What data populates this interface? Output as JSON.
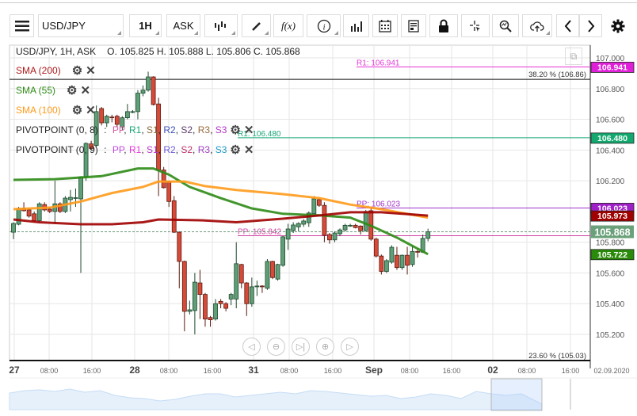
{
  "toolbar": {
    "menu_icon": "hamburger-icon",
    "symbol": "USD/JPY",
    "interval": "1H",
    "price_type": "ASK",
    "buttons": [
      "candlestick-icon",
      "pencil-icon",
      "function-icon",
      "info-icon",
      "bar-chart-icon",
      "calendar-icon",
      "document-icon",
      "lock-icon",
      "crosshair-icon",
      "zoom-chart-icon",
      "cloud-upload-icon",
      "chevron-left-icon",
      "chevron-right-icon",
      "gear-icon"
    ],
    "fx_label": "f(x)"
  },
  "header": {
    "title": "USD/JPY, 1H, ASK",
    "ohlc": "O. 105.825  H. 105.888  L. 105.806  C. 105.868"
  },
  "indicators": [
    {
      "label": "SMA (200)",
      "color": "#b0181b"
    },
    {
      "label": "SMA (55)",
      "color": "#2e8b16"
    },
    {
      "label": "SMA (100)",
      "color": "#ff9a1a"
    }
  ],
  "pivots": [
    {
      "label": "PIVOTPOINT (0, 8)",
      "sep": " : ",
      "levels": [
        {
          "t": "PP",
          "c": "#d45aa0"
        },
        {
          "t": "R1",
          "c": "#19a678"
        },
        {
          "t": "S1",
          "c": "#8b6a3a"
        },
        {
          "t": "R2",
          "c": "#3b4fb5"
        },
        {
          "t": "S2",
          "c": "#5a3a6a"
        },
        {
          "t": "R3",
          "c": "#9a6a3a"
        },
        {
          "t": "S3",
          "c": "#b535c8"
        }
      ]
    },
    {
      "label": "PIVOTPOINT (0, 9)",
      "sep": " : ",
      "levels": [
        {
          "t": "PP",
          "c": "#c048e0"
        },
        {
          "t": "R1",
          "c": "#e535d8"
        },
        {
          "t": "S1",
          "c": "#b535c8"
        },
        {
          "t": "R2",
          "c": "#6a5ad8"
        },
        {
          "t": "S2",
          "c": "#c0306a"
        },
        {
          "t": "R3",
          "c": "#a040c0"
        },
        {
          "t": "S3",
          "c": "#1a9ac8"
        }
      ]
    }
  ],
  "levels": {
    "r1_a": {
      "label": "R1: 106.941",
      "value": 106.941,
      "color": "#e535d8"
    },
    "r1_b": {
      "label": "R1: 106.480",
      "value": 106.48,
      "color": "#19a678"
    },
    "pp_a": {
      "label": "PP: 106.023",
      "value": 106.023,
      "color": "#a030c8"
    },
    "pp_b": {
      "label": "PP: 105.842",
      "value": 105.842,
      "color": "#d040a0"
    },
    "fib_top": {
      "label": "38.20 % (106.86)",
      "value": 106.86
    },
    "fib_bottom": {
      "label": "23.60 % (105.03)",
      "value": 105.03
    }
  },
  "price_tags": [
    {
      "text": "106.941",
      "value": 106.941,
      "bg": "#e020d8"
    },
    {
      "text": "106.480",
      "value": 106.48,
      "bg": "#13a86e"
    },
    {
      "text": "106.023",
      "value": 106.023,
      "bg": "#a020c8"
    },
    {
      "text": "105.973",
      "value": 105.973,
      "bg": "#a00000"
    },
    {
      "text": "105.722",
      "value": 105.722,
      "bg": "#2a8a0a"
    }
  ],
  "current_price": {
    "text": "105.868",
    "value": 105.868,
    "bg": "#6aa07a"
  },
  "nav_buttons": [
    "scroll-left-icon",
    "zoom-out-icon",
    "reset-icon",
    "zoom-in-icon",
    "scroll-right-icon"
  ],
  "chart_data": {
    "type": "candlestick",
    "yaxis": {
      "ticks": [
        "107.000",
        "106.800",
        "106.600",
        "106.400",
        "106.200",
        "105.800",
        "105.600",
        "105.400",
        "105.200"
      ],
      "ylim": [
        105.1,
        107.08
      ]
    },
    "xaxis": {
      "ticks": [
        "27",
        "08:00",
        "16:00",
        "28",
        "08:00",
        "16:00",
        "31",
        "08:00",
        "16:00",
        "Sep",
        "08:00",
        "16:00",
        "02",
        "08:00",
        "16:00"
      ],
      "date_label": "02.09.2020"
    },
    "colors": {
      "up": "#5f9e77",
      "down": "#d84a38"
    },
    "ohlc": [
      [
        105.865,
        105.93,
        105.82,
        105.922
      ],
      [
        105.917,
        106.03,
        105.91,
        106.02
      ],
      [
        106.02,
        106.06,
        106.0,
        106.005
      ],
      [
        106.01,
        106.02,
        105.96,
        105.97
      ],
      [
        105.985,
        106.0,
        105.93,
        105.94
      ],
      [
        105.94,
        106.06,
        105.93,
        106.05
      ],
      [
        106.045,
        106.06,
        106.0,
        106.01
      ],
      [
        106.015,
        106.03,
        105.99,
        106.0
      ],
      [
        106.0,
        106.2,
        105.92,
        106.05
      ],
      [
        106.05,
        106.06,
        105.99,
        106.0
      ],
      [
        106.0,
        106.1,
        105.99,
        106.087
      ],
      [
        106.077,
        106.14,
        106.0,
        106.092
      ],
      [
        106.085,
        106.15,
        106.03,
        106.09
      ],
      [
        106.082,
        106.23,
        105.6,
        106.226
      ],
      [
        106.226,
        106.45,
        106.2,
        106.443
      ],
      [
        106.44,
        106.46,
        106.4,
        106.41
      ],
      [
        106.43,
        106.69,
        106.42,
        106.65
      ],
      [
        106.67,
        106.68,
        106.56,
        106.577
      ],
      [
        106.577,
        106.63,
        106.55,
        106.62
      ],
      [
        106.615,
        106.63,
        106.58,
        106.61
      ],
      [
        106.62,
        106.63,
        106.55,
        106.567
      ],
      [
        106.55,
        106.62,
        106.53,
        106.61
      ],
      [
        106.61,
        106.7,
        106.6,
        106.65
      ],
      [
        106.65,
        106.66,
        106.64,
        106.65
      ],
      [
        106.65,
        106.79,
        106.6,
        106.77
      ],
      [
        106.77,
        106.82,
        106.75,
        106.79
      ],
      [
        106.79,
        106.91,
        106.78,
        106.876
      ],
      [
        106.876,
        106.88,
        106.69,
        106.696
      ],
      [
        106.7,
        106.74,
        106.1,
        106.27
      ],
      [
        106.27,
        106.29,
        106.15,
        106.155
      ],
      [
        106.195,
        106.2,
        106.03,
        106.065
      ],
      [
        106.07,
        106.1,
        105.86,
        105.865
      ],
      [
        105.865,
        105.87,
        105.5,
        105.675
      ],
      [
        105.675,
        105.68,
        105.22,
        105.35
      ],
      [
        105.35,
        105.42,
        105.33,
        105.36
      ],
      [
        105.355,
        105.6,
        105.2,
        105.54
      ],
      [
        105.535,
        105.62,
        105.3,
        105.46
      ],
      [
        105.46,
        105.47,
        105.25,
        105.3
      ],
      [
        105.31,
        105.32,
        105.25,
        105.295
      ],
      [
        105.3,
        105.43,
        105.29,
        105.4
      ],
      [
        105.415,
        105.43,
        105.37,
        105.4
      ],
      [
        105.4,
        105.41,
        105.35,
        105.37
      ],
      [
        105.43,
        105.47,
        105.39,
        105.46
      ],
      [
        105.43,
        105.8,
        105.37,
        105.66
      ],
      [
        105.655,
        105.66,
        105.5,
        105.535
      ],
      [
        105.535,
        105.54,
        105.32,
        105.4
      ],
      [
        105.4,
        105.57,
        105.38,
        105.51
      ],
      [
        105.51,
        105.55,
        105.45,
        105.515
      ],
      [
        105.515,
        105.52,
        105.47,
        105.51
      ],
      [
        105.5,
        105.69,
        105.49,
        105.675
      ],
      [
        105.675,
        105.68,
        105.56,
        105.57
      ],
      [
        105.56,
        105.66,
        105.55,
        105.655
      ],
      [
        105.65,
        105.84,
        105.64,
        105.835
      ],
      [
        105.82,
        105.92,
        105.75,
        105.886
      ],
      [
        105.876,
        105.93,
        105.86,
        105.912
      ],
      [
        105.9,
        105.93,
        105.87,
        105.922
      ],
      [
        105.917,
        105.95,
        105.9,
        105.938
      ],
      [
        105.927,
        106.0,
        105.9,
        105.99
      ],
      [
        105.985,
        106.1,
        105.98,
        106.082
      ],
      [
        106.077,
        106.09,
        106.03,
        106.04
      ],
      [
        106.04,
        106.06,
        105.8,
        105.845
      ],
      [
        105.85,
        105.86,
        105.79,
        105.815
      ],
      [
        105.815,
        105.87,
        105.8,
        105.86
      ],
      [
        105.855,
        105.89,
        105.84,
        105.88
      ],
      [
        105.88,
        105.92,
        105.87,
        105.91
      ],
      [
        105.905,
        105.92,
        105.9,
        105.91
      ],
      [
        105.91,
        105.92,
        105.89,
        105.895
      ],
      [
        105.905,
        105.91,
        105.85,
        105.875
      ],
      [
        105.875,
        106.01,
        105.87,
        106.0
      ],
      [
        106.005,
        106.03,
        105.81,
        105.82
      ],
      [
        105.82,
        105.83,
        105.7,
        105.71
      ],
      [
        105.71,
        105.72,
        105.59,
        105.61
      ],
      [
        105.61,
        105.69,
        105.6,
        105.68
      ],
      [
        105.67,
        105.78,
        105.66,
        105.767
      ],
      [
        105.715,
        105.77,
        105.62,
        105.635
      ],
      [
        105.635,
        105.72,
        105.62,
        105.715
      ],
      [
        105.715,
        105.77,
        105.59,
        105.65
      ],
      [
        105.655,
        105.78,
        105.64,
        105.74
      ],
      [
        105.74,
        105.76,
        105.7,
        105.735
      ],
      [
        105.735,
        105.85,
        105.73,
        105.825
      ],
      [
        105.825,
        105.888,
        105.806,
        105.868
      ]
    ],
    "sma": [
      {
        "name": "SMA (55)",
        "color": "#2e8b16",
        "points": [
          [
            0,
            106.206
          ],
          [
            8,
            106.21
          ],
          [
            17,
            106.23
          ],
          [
            24,
            106.28
          ],
          [
            27,
            106.28
          ],
          [
            30,
            106.24
          ],
          [
            34,
            106.16
          ],
          [
            40,
            106.087
          ],
          [
            46,
            106.02
          ],
          [
            52,
            105.985
          ],
          [
            59,
            105.975
          ],
          [
            65,
            105.96
          ],
          [
            69,
            105.907
          ],
          [
            74,
            105.83
          ],
          [
            80,
            105.722
          ]
        ]
      },
      {
        "name": "SMA (100)",
        "color": "#ff9a1a",
        "points": [
          [
            0,
            106.015
          ],
          [
            7,
            106.025
          ],
          [
            13,
            106.065
          ],
          [
            19,
            106.12
          ],
          [
            25,
            106.16
          ],
          [
            28,
            106.195
          ],
          [
            33,
            106.195
          ],
          [
            37,
            106.165
          ],
          [
            43,
            106.14
          ],
          [
            52,
            106.113
          ],
          [
            59,
            106.087
          ],
          [
            65,
            106.045
          ],
          [
            71,
            106.015
          ],
          [
            80,
            105.96
          ]
        ]
      },
      {
        "name": "SMA (200)",
        "color": "#a00000",
        "points": [
          [
            0,
            105.948
          ],
          [
            5,
            105.93
          ],
          [
            13,
            105.917
          ],
          [
            19,
            105.917
          ],
          [
            25,
            105.93
          ],
          [
            28,
            105.948
          ],
          [
            36,
            105.943
          ],
          [
            43,
            105.93
          ],
          [
            52,
            105.953
          ],
          [
            59,
            105.974
          ],
          [
            65,
            105.995
          ],
          [
            71,
            105.995
          ],
          [
            80,
            105.973
          ]
        ]
      }
    ]
  }
}
